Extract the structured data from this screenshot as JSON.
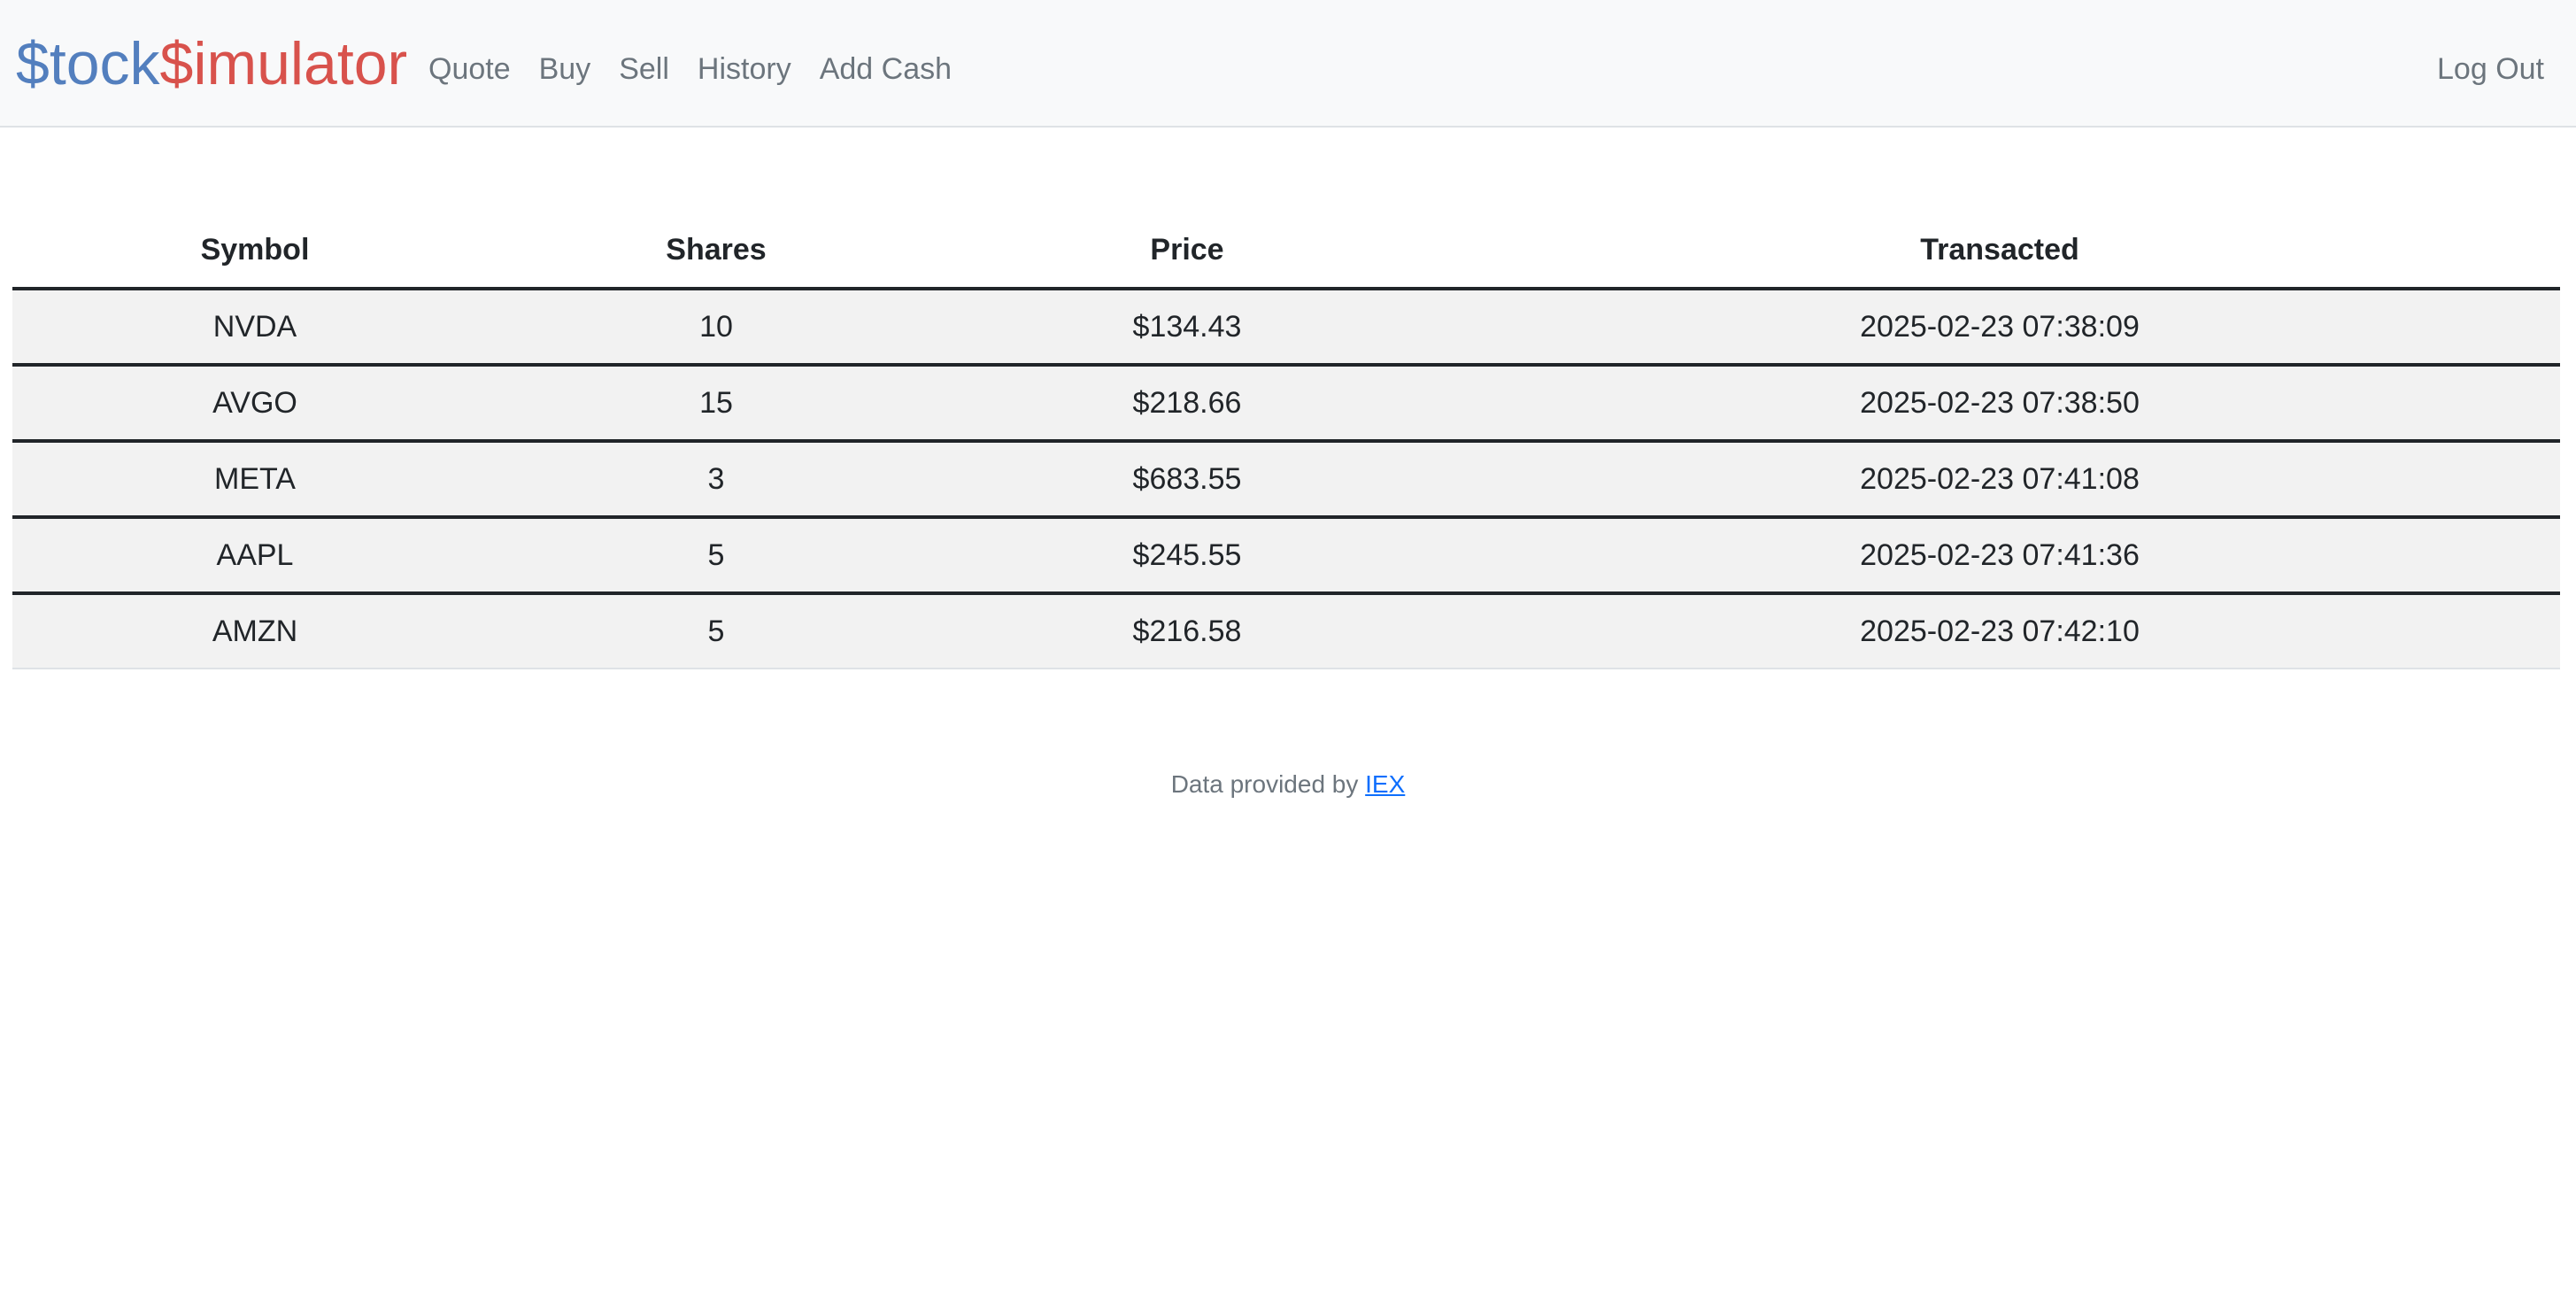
{
  "brand": {
    "part1": "$tock",
    "part2": "$imulator",
    "color_blue": "#537fbe",
    "color_red": "#d8524c"
  },
  "nav": {
    "items": [
      {
        "label": "Quote"
      },
      {
        "label": "Buy"
      },
      {
        "label": "Sell"
      },
      {
        "label": "History"
      },
      {
        "label": "Add Cash"
      }
    ],
    "logout_label": "Log Out"
  },
  "table": {
    "headers": {
      "symbol": "Symbol",
      "shares": "Shares",
      "price": "Price",
      "transacted": "Transacted"
    },
    "rows": [
      {
        "symbol": "NVDA",
        "shares": "10",
        "price": "$134.43",
        "transacted": "2025-02-23 07:38:09"
      },
      {
        "symbol": "AVGO",
        "shares": "15",
        "price": "$218.66",
        "transacted": "2025-02-23 07:38:50"
      },
      {
        "symbol": "META",
        "shares": "3",
        "price": "$683.55",
        "transacted": "2025-02-23 07:41:08"
      },
      {
        "symbol": "AAPL",
        "shares": "5",
        "price": "$245.55",
        "transacted": "2025-02-23 07:41:36"
      },
      {
        "symbol": "AMZN",
        "shares": "5",
        "price": "$216.58",
        "transacted": "2025-02-23 07:42:10"
      }
    ]
  },
  "footer": {
    "prefix": "Data provided by",
    "link_label": "IEX"
  }
}
